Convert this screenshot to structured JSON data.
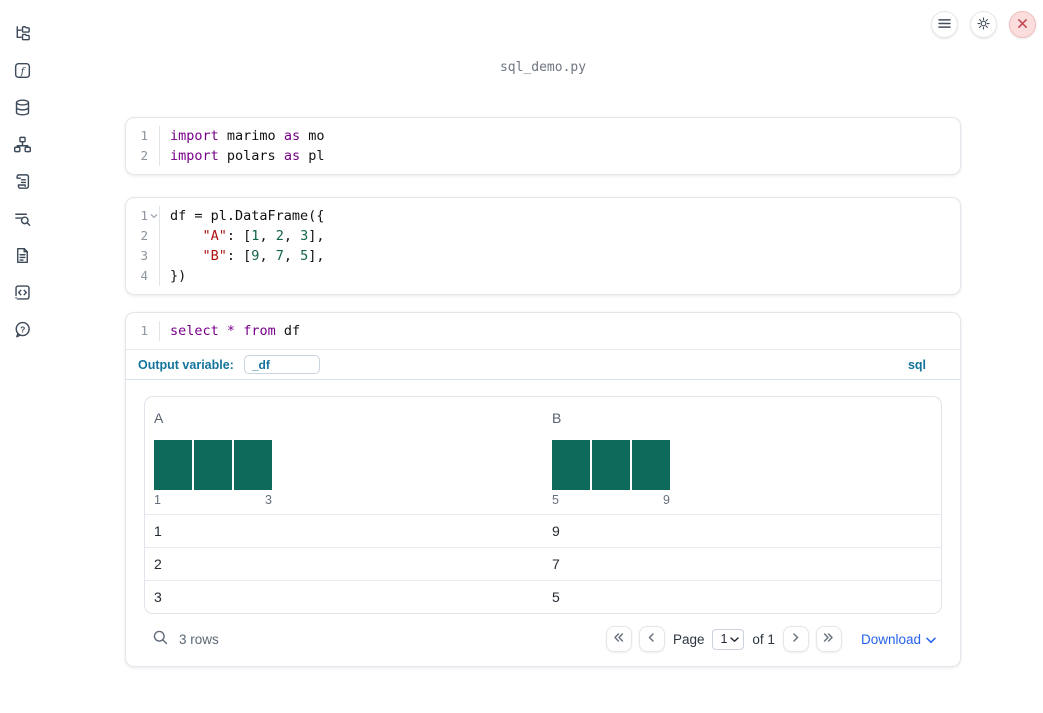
{
  "title": "sql_demo.py",
  "topbar": {
    "buttons": [
      "menu",
      "settings",
      "close"
    ]
  },
  "sidebar": {
    "icons": [
      "file-tree",
      "functions",
      "datasources",
      "dependency-graph",
      "logs",
      "outline-search",
      "documentation",
      "snippets",
      "help"
    ]
  },
  "cells": [
    {
      "type": "python",
      "lines": [
        {
          "num": "1",
          "tokens": [
            [
              "k",
              "import"
            ],
            [
              "p",
              " marimo "
            ],
            [
              "k",
              "as"
            ],
            [
              "p",
              " mo"
            ]
          ]
        },
        {
          "num": "2",
          "tokens": [
            [
              "k",
              "import"
            ],
            [
              "p",
              " polars "
            ],
            [
              "k",
              "as"
            ],
            [
              "p",
              " pl"
            ]
          ]
        }
      ]
    },
    {
      "type": "python",
      "lines": [
        {
          "num": "1",
          "fold": true,
          "tokens": [
            [
              "p",
              "df = pl.DataFrame({"
            ]
          ]
        },
        {
          "num": "2",
          "tokens": [
            [
              "p",
              "    "
            ],
            [
              "s",
              "\"A\""
            ],
            [
              "p",
              ": ["
            ],
            [
              "n",
              "1"
            ],
            [
              "p",
              ", "
            ],
            [
              "n",
              "2"
            ],
            [
              "p",
              ", "
            ],
            [
              "n",
              "3"
            ],
            [
              "p",
              "],"
            ]
          ]
        },
        {
          "num": "3",
          "tokens": [
            [
              "p",
              "    "
            ],
            [
              "s",
              "\"B\""
            ],
            [
              "p",
              ": ["
            ],
            [
              "n",
              "9"
            ],
            [
              "p",
              ", "
            ],
            [
              "n",
              "7"
            ],
            [
              "p",
              ", "
            ],
            [
              "n",
              "5"
            ],
            [
              "p",
              "],"
            ]
          ]
        },
        {
          "num": "4",
          "tokens": [
            [
              "p",
              "})"
            ]
          ]
        }
      ]
    },
    {
      "type": "sql",
      "lines": [
        {
          "num": "1",
          "tokens": [
            [
              "k",
              "select"
            ],
            [
              "p",
              " "
            ],
            [
              "k",
              "*"
            ],
            [
              "p",
              " "
            ],
            [
              "k",
              "from"
            ],
            [
              "p",
              " df"
            ]
          ]
        }
      ]
    }
  ],
  "sql_cell": {
    "output_variable_label": "Output variable:",
    "output_variable_value": "_df",
    "language_badge": "sql"
  },
  "table": {
    "columns": [
      {
        "name": "A",
        "histogram": {
          "type": "bar",
          "values": [
            1,
            1,
            1
          ],
          "min_label": "1",
          "max_label": "3"
        }
      },
      {
        "name": "B",
        "histogram": {
          "type": "bar",
          "values": [
            1,
            1,
            1
          ],
          "min_label": "5",
          "max_label": "9"
        }
      }
    ],
    "rows": [
      [
        "1",
        "9"
      ],
      [
        "2",
        "7"
      ],
      [
        "3",
        "5"
      ]
    ],
    "footer": {
      "row_count": "3 rows",
      "page_label": "Page",
      "page_value": "1",
      "of_label": "of 1",
      "download_label": "Download"
    }
  },
  "colors": {
    "histogram_bar": "#0e6b5c",
    "accent_blue": "#2563eb",
    "sql_accent": "#13739b",
    "keyword": "#770088",
    "string": "#aa1111",
    "number": "#116644",
    "close_red": "#c64754"
  }
}
